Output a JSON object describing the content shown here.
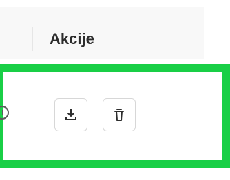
{
  "header": {
    "title": "Akcije"
  },
  "actions": [
    {
      "icon": "download-icon"
    },
    {
      "icon": "trash-icon"
    }
  ],
  "highlight": {
    "color": "#19cf46"
  },
  "row": {
    "left_icon": "info-icon"
  }
}
